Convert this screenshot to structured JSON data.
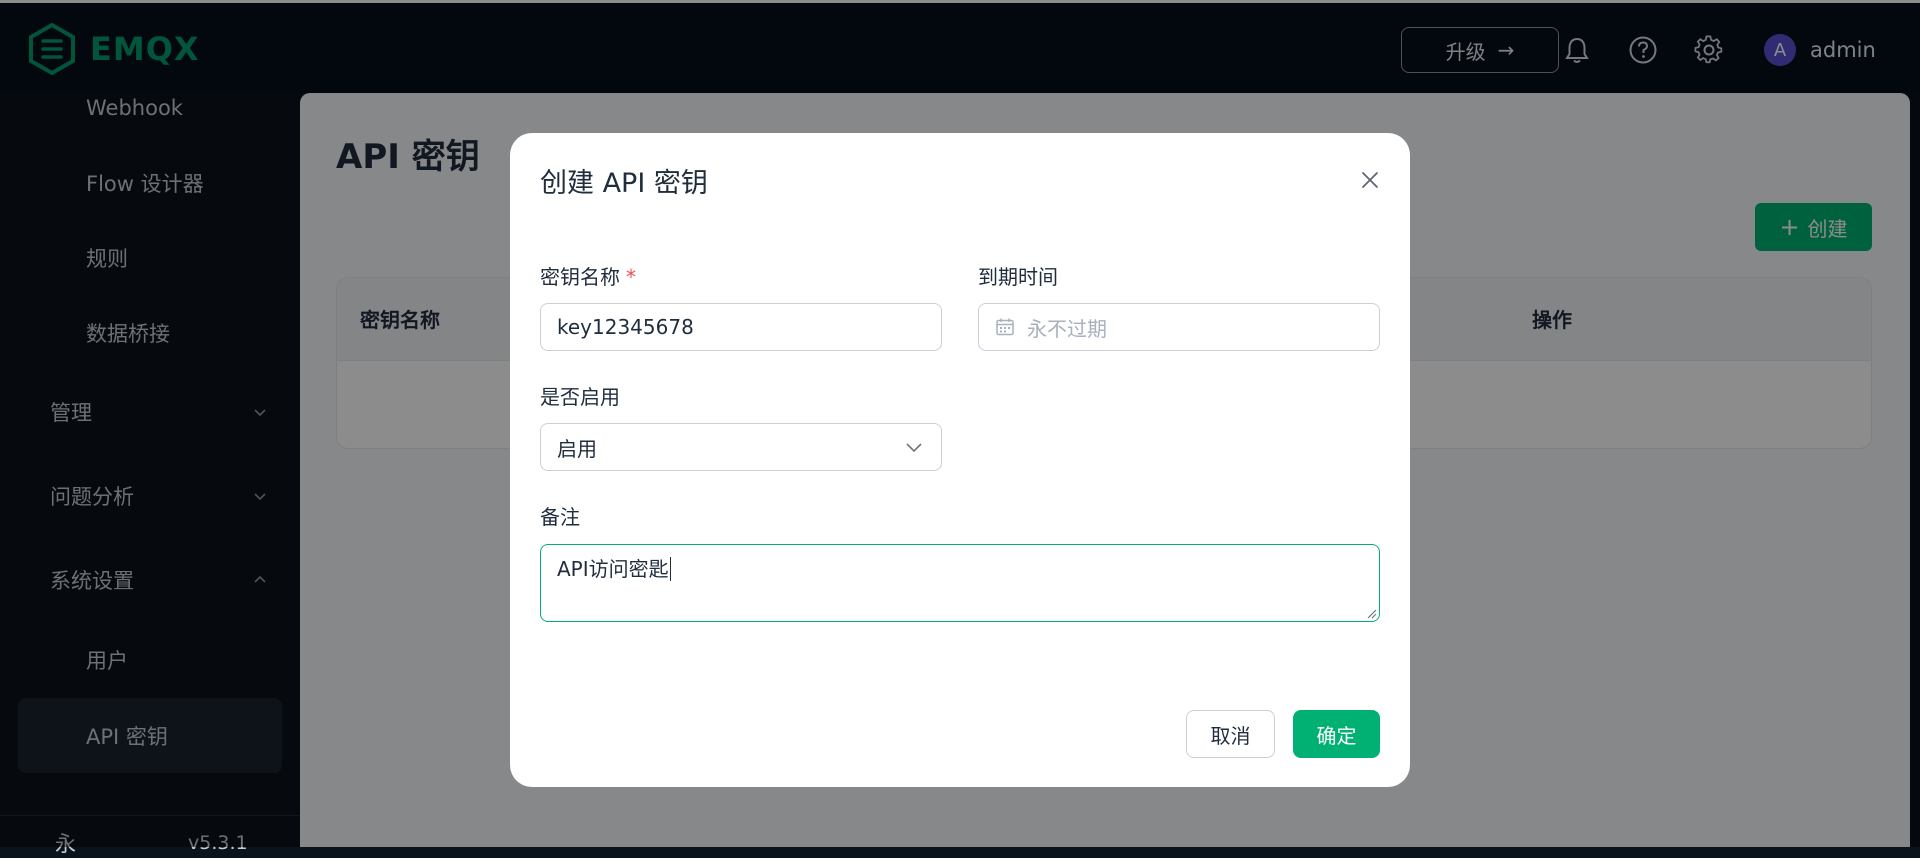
{
  "header": {
    "brand": "EMQX",
    "upgrade_label": "升级",
    "upgrade_arrow": "→",
    "avatar_letter": "A",
    "username": "admin",
    "icons": [
      "bell-icon",
      "help-icon",
      "gear-icon"
    ]
  },
  "sidebar": {
    "items": [
      {
        "label": "Webhook",
        "type": "sub"
      },
      {
        "label": "Flow 设计器",
        "type": "sub"
      },
      {
        "label": "规则",
        "type": "sub"
      },
      {
        "label": "数据桥接",
        "type": "sub"
      },
      {
        "label": "管理",
        "type": "group",
        "expanded": false
      },
      {
        "label": "问题分析",
        "type": "group",
        "expanded": false
      },
      {
        "label": "系统设置",
        "type": "group",
        "expanded": true
      },
      {
        "label": "用户",
        "type": "sub"
      },
      {
        "label": "API 密钥",
        "type": "sub",
        "active": true
      }
    ],
    "footer_char": "永",
    "version": "v5.3.1"
  },
  "main": {
    "title": "API 密钥",
    "create_label": "创建",
    "table": {
      "columns": [
        "密钥名称",
        "操作"
      ]
    }
  },
  "dialog": {
    "title": "创建 API 密钥",
    "fields": {
      "name": {
        "label": "密钥名称",
        "required_mark": "*",
        "value": "key12345678"
      },
      "expiry": {
        "label": "到期时间",
        "placeholder": "永不过期"
      },
      "enabled": {
        "label": "是否启用",
        "value": "启用"
      },
      "note": {
        "label": "备注",
        "value": "API访问密匙"
      }
    },
    "cancel_label": "取消",
    "confirm_label": "确定"
  },
  "colors": {
    "accent": "#00b173",
    "brand": "#009c6b",
    "required": "#f04d4d",
    "avatar": "#5a4fd1"
  }
}
